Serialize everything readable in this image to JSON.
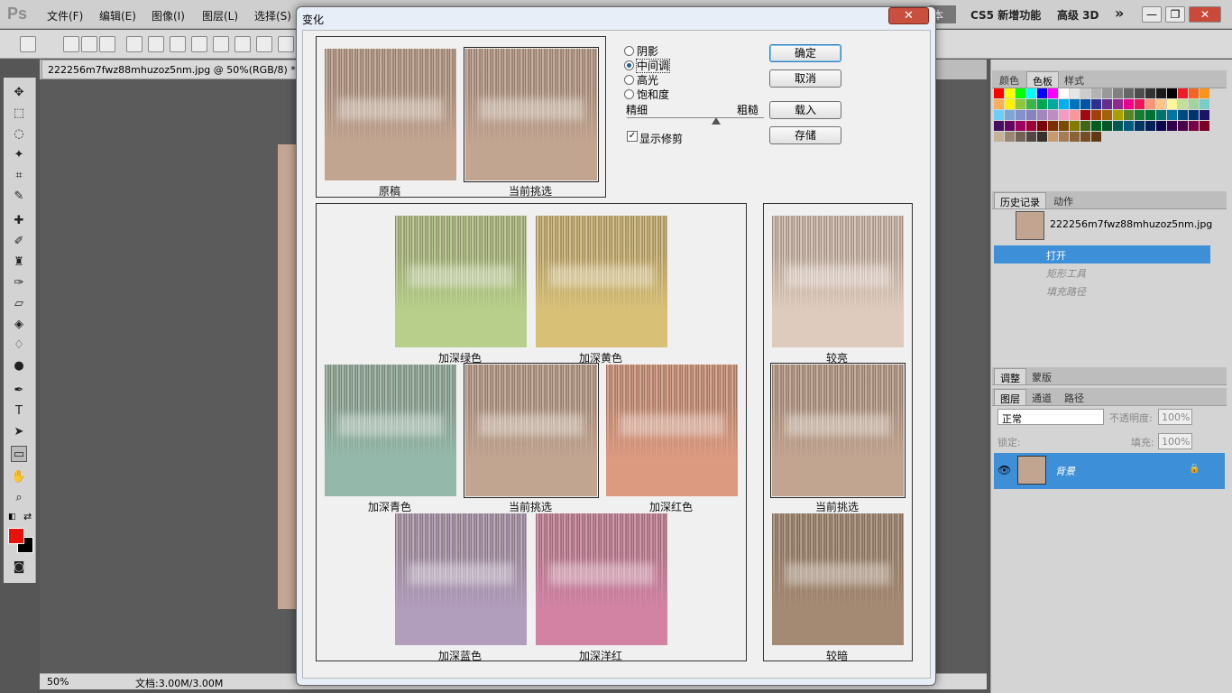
{
  "app": {
    "logo": "Ps",
    "menu": [
      "文件(F)",
      "编辑(E)",
      "图像(I)",
      "图层(L)",
      "选择(S)"
    ],
    "workspace": {
      "active": "本",
      "cs5": "CS5 新增功能",
      "adv3d": "高级 3D",
      "more": "»"
    },
    "window_buttons": {
      "minimize": "—",
      "restore": "❐",
      "close": "✕"
    }
  },
  "document": {
    "tab_title": "222256m7fwz88mhuzoz5nm.jpg @ 50%(RGB/8) *",
    "zoom": "50%",
    "doc_size": "文档:3.00M/3.00M"
  },
  "panels": {
    "color_tabs": [
      "颜色",
      "色板",
      "样式"
    ],
    "history_tabs": [
      "历史记录",
      "动作"
    ],
    "history_snapshot": "222256m7fwz88mhuzoz5nm.jpg",
    "history_items": [
      "打开",
      "矩形工具",
      "填充路径"
    ],
    "adjust_tabs": [
      "调整",
      "蒙版"
    ],
    "layer_tabs": [
      "图层",
      "通道",
      "路径"
    ],
    "blend_mode": "正常",
    "opacity_label": "不透明度:",
    "opacity_value": "100%",
    "lock_label": "锁定:",
    "fill_label": "填充:",
    "fill_value": "100%",
    "layer_name": "背景"
  },
  "swatch_colors": [
    "#ff0000",
    "#ffff00",
    "#00ff00",
    "#00ffff",
    "#0000ff",
    "#ff00ff",
    "#ffffff",
    "#e6e6e6",
    "#cccccc",
    "#b3b3b3",
    "#999999",
    "#808080",
    "#666666",
    "#4d4d4d",
    "#333333",
    "#1a1a1a",
    "#000000",
    "#ee1c24",
    "#f26522",
    "#f7941d",
    "#fbaf5d",
    "#fff200",
    "#8dc63f",
    "#39b54a",
    "#00a651",
    "#00a99d",
    "#00aeef",
    "#0072bc",
    "#0054a6",
    "#2e3192",
    "#662d91",
    "#92278f",
    "#ec008c",
    "#ed145b",
    "#f69679",
    "#fdc689",
    "#fff799",
    "#c4df9b",
    "#a3d39c",
    "#7accc8",
    "#6dcff6",
    "#7da7d9",
    "#8393ca",
    "#8781bd",
    "#a186be",
    "#bc8dbf",
    "#f49ac1",
    "#f5989d",
    "#9e0b0f",
    "#a0410d",
    "#a36209",
    "#aba000",
    "#598527",
    "#197b30",
    "#007236",
    "#00746b",
    "#0076a3",
    "#004a80",
    "#003471",
    "#1b1464",
    "#440e62",
    "#630460",
    "#9e005d",
    "#9e0039",
    "#790000",
    "#7b2e00",
    "#7d4900",
    "#827b00",
    "#406618",
    "#005e20",
    "#005826",
    "#005952",
    "#005b7f",
    "#003663",
    "#002157",
    "#0d004c",
    "#32004b",
    "#4b0049",
    "#7b0046",
    "#7a0026",
    "#c7b299",
    "#998675",
    "#736357",
    "#534741",
    "#362f2d",
    "#c69c6d",
    "#a67c52",
    "#8c6239",
    "#754c24",
    "#603913"
  ],
  "dialog": {
    "title": "变化",
    "close": "✕",
    "top_captions": {
      "original": "原稿",
      "current": "当前挑选"
    },
    "options": {
      "shadows": "阴影",
      "midtones": "中间调",
      "highlights": "高光",
      "saturation": "饱和度",
      "selected": "midtones",
      "fine": "精细",
      "coarse": "粗糙",
      "fine_coarse_level": 0.65,
      "show_clipping": "显示修剪",
      "show_clipping_checked": true
    },
    "buttons": {
      "ok": "确定",
      "cancel": "取消",
      "load": "载入",
      "save": "存储"
    },
    "variations": {
      "more_green": "加深绿色",
      "more_yellow": "加深黄色",
      "more_cyan": "加深青色",
      "current": "当前挑选",
      "more_red": "加深红色",
      "more_blue": "加深蓝色",
      "more_magenta": "加深洋红"
    },
    "brightness": {
      "lighter": "较亮",
      "current": "当前挑选",
      "darker": "较暗"
    },
    "tint_colors": {
      "original": "#c2a591",
      "current": "#c2a591",
      "green": "#b7cf8a",
      "yellow": "#d8c077",
      "cyan": "#94b9aa",
      "red": "#dc9a80",
      "blue": "#b19dbc",
      "magenta": "#d283a4",
      "lighter": "#dfcbbd",
      "darker": "#a58a73"
    }
  }
}
